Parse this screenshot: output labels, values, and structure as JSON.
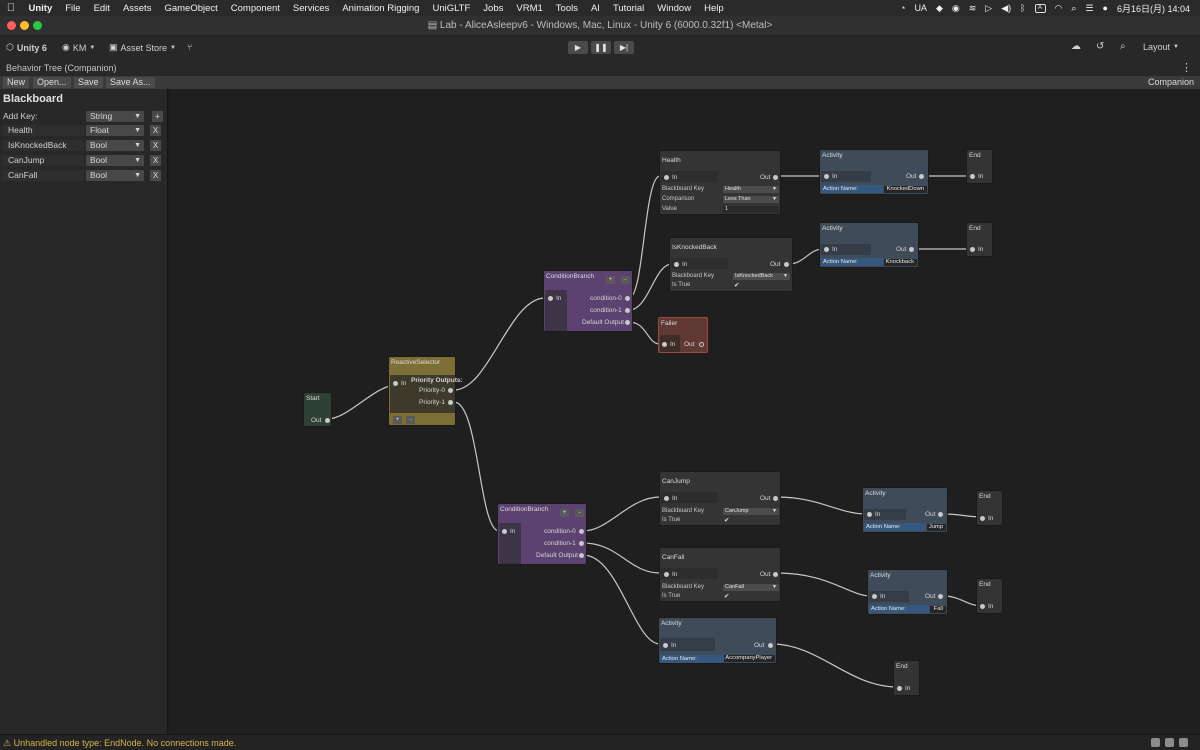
{
  "menubar": {
    "app": "Unity",
    "items": [
      "File",
      "Edit",
      "Assets",
      "GameObject",
      "Component",
      "Services",
      "Animation Rigging",
      "UniGLTF",
      "Jobs",
      "VRM1",
      "Tools",
      "AI",
      "Tutorial",
      "Window",
      "Help"
    ],
    "input_source": "UA",
    "input_mode": "A",
    "clock": "6月16日(月)  14:04"
  },
  "window": {
    "title": "Lab - AliceAsleepv6 - Windows, Mac, Linux - Unity 6 (6000.0.32f1) <Metal>"
  },
  "toolbar": {
    "unity_label": "Unity 6",
    "account_label": "KM",
    "asset_store_label": "Asset Store",
    "layout_label": "Layout"
  },
  "editor_tab": {
    "title": "Behavior Tree (Companion)"
  },
  "graph_toolbar": {
    "new_label": "New",
    "open_label": "Open...",
    "save_label": "Save",
    "save_as_label": "Save As...",
    "tree_name": "Companion"
  },
  "blackboard": {
    "title": "Blackboard",
    "add_key_label": "Add Key:",
    "add_key_type": "String",
    "add_button": "+",
    "remove_label": "X",
    "keys": [
      {
        "name": "Health",
        "type": "Float"
      },
      {
        "name": "IsKnockedBack",
        "type": "Bool"
      },
      {
        "name": "CanJump",
        "type": "Bool"
      },
      {
        "name": "CanFall",
        "type": "Bool"
      }
    ]
  },
  "labels": {
    "in": "In",
    "out": "Out",
    "blackboard_key": "Blackboard Key",
    "comparison": "Comparison",
    "value": "Value",
    "is_true": "Is True",
    "action_name": "Action Name:",
    "condition_0": "condition-0",
    "condition_1": "condition-1",
    "default_output": "Default Output",
    "priority_outputs": "Priority Outputs:",
    "priority_0": "Priority-0",
    "priority_1": "Priority-1",
    "plus": "+",
    "minus": "-",
    "check": "✔"
  },
  "nodes": {
    "start": {
      "title": "Start"
    },
    "reactive_selector": {
      "title": "ReactiveSelector"
    },
    "condition_branch_1": {
      "title": "ConditionBranch"
    },
    "condition_branch_2": {
      "title": "ConditionBranch"
    },
    "health": {
      "title": "Health",
      "key": "Health",
      "comparison": "Less Than",
      "value": "1"
    },
    "is_knocked_back": {
      "title": "IsKnockedBack",
      "key": "IsKnockedBack",
      "is_true": true
    },
    "failer": {
      "title": "Failer"
    },
    "activity_knocked_down": {
      "title": "Activity",
      "action": "KnockedDown"
    },
    "activity_knockback": {
      "title": "Activity",
      "action": "Knockback"
    },
    "end_1": {
      "title": "End"
    },
    "end_2": {
      "title": "End"
    },
    "can_jump": {
      "title": "CanJump",
      "key": "CanJump",
      "is_true": true
    },
    "can_fall": {
      "title": "CanFall",
      "key": "CanFall",
      "is_true": true
    },
    "activity_jump": {
      "title": "Activity",
      "action": "Jump"
    },
    "activity_fall": {
      "title": "Activity",
      "action": "Fall"
    },
    "activity_accompany": {
      "title": "Activity",
      "action": "AccompanyPlayer"
    },
    "end_3": {
      "title": "End"
    },
    "end_4": {
      "title": "End"
    },
    "end_5": {
      "title": "End"
    }
  },
  "status": {
    "message": "Unhandled node type: EndNode. No connections made."
  },
  "colors": {
    "condition_branch": "#5b4270",
    "reactive_selector": "#7d6e36",
    "start": "#2e4036",
    "failer": "#603934",
    "activity": "#3f4b58",
    "warning_text": "#d9b24a"
  }
}
